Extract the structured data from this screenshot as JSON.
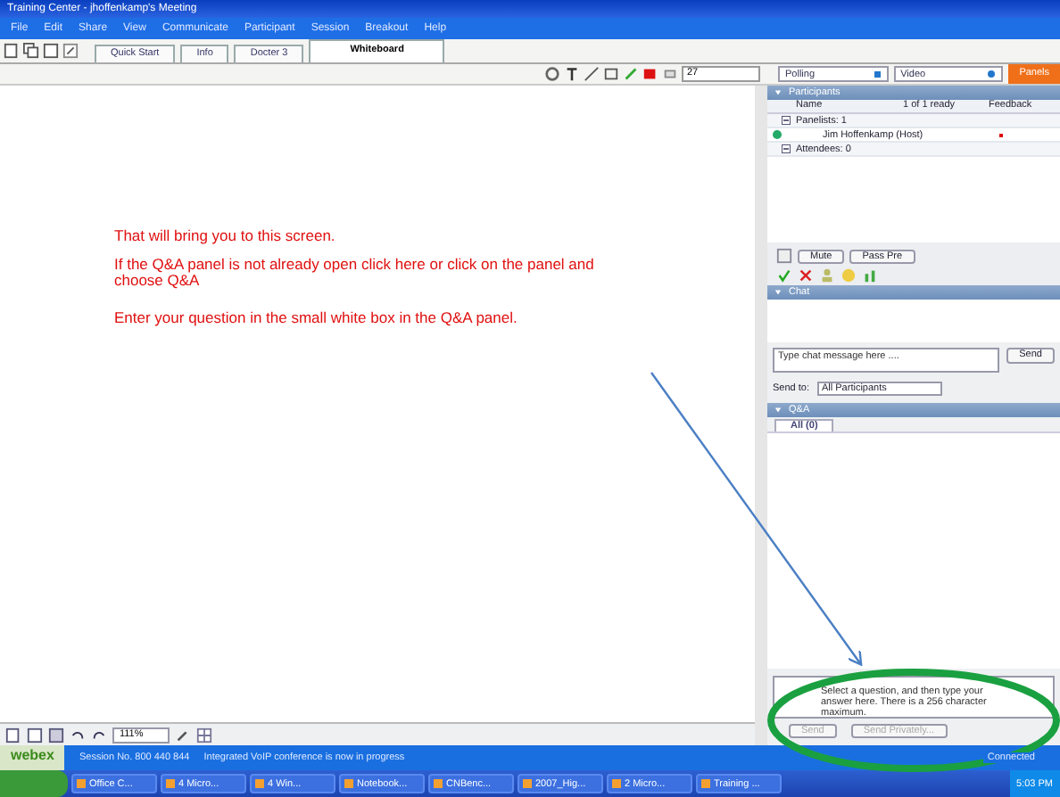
{
  "window": {
    "title": "Training Center - jhoffenkamp's Meeting"
  },
  "menu": [
    "File",
    "Edit",
    "Share",
    "View",
    "Communicate",
    "Participant",
    "Session",
    "Breakout",
    "Help"
  ],
  "doc_tabs": [
    {
      "label": "Quick Start",
      "selected": false
    },
    {
      "label": "Info",
      "selected": false
    },
    {
      "label": "Docter 3",
      "selected": false
    },
    {
      "label": "Whiteboard",
      "selected": true
    }
  ],
  "whiteboard": {
    "size_field": "27",
    "zoom": "111%",
    "annotations": [
      "That will bring you to this screen.",
      "If the Q&A panel is not already open click here or click on the panel and choose Q&A",
      "Enter your question in the small white box in the Q&A panel."
    ]
  },
  "panel_bar": {
    "polling": "Polling",
    "video": "Video",
    "panels": "Panels"
  },
  "participants": {
    "title": "Participants",
    "columns": [
      "Name",
      "1 of 1 ready",
      "Feedback"
    ],
    "groups": [
      {
        "label": "Panelists: 1",
        "expanded": true,
        "members": [
          {
            "name": "Jim Hoffenkamp (Host)"
          }
        ]
      },
      {
        "label": "Attendees: 0",
        "expanded": true
      }
    ],
    "buttons": [
      "Mute",
      "Pass Pre"
    ]
  },
  "chat": {
    "title": "Chat",
    "placeholder": "Type chat message here ....",
    "send": "Send",
    "send_to_label": "Send to:",
    "send_to": "All Participants"
  },
  "qa": {
    "title": "Q&A",
    "tabs": [
      {
        "label": "All (0)",
        "selected": true
      }
    ],
    "answer_placeholder": "Select a question, and then type your answer here. There is a 256 character maximum.",
    "buttons": [
      {
        "label": "Send",
        "disabled": true
      },
      {
        "label": "Send Privately...",
        "disabled": true
      }
    ]
  },
  "status_bar": {
    "logo": "webex",
    "session": "Session No. 800 440 844",
    "message": "Integrated VoIP conference is now in progress",
    "connection": "Connected"
  },
  "taskbar": {
    "items": [
      {
        "label": "Office C..."
      },
      {
        "label": "4 Micro..."
      },
      {
        "label": "4 Win..."
      },
      {
        "label": "Notebook..."
      },
      {
        "label": "CNBenc..."
      },
      {
        "label": "2007_Hig..."
      },
      {
        "label": "2 Micro..."
      },
      {
        "label": "Training ..."
      }
    ],
    "clock": "5:03 PM"
  }
}
